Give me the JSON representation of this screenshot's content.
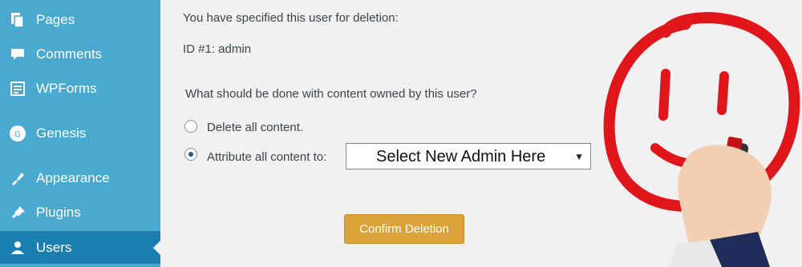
{
  "sidebar": {
    "items": [
      {
        "label": "Pages",
        "icon": "pages-icon"
      },
      {
        "label": "Comments",
        "icon": "comments-icon"
      },
      {
        "label": "WPForms",
        "icon": "wpforms-icon"
      },
      {
        "label": "Genesis",
        "icon": "genesis-icon"
      },
      {
        "label": "Appearance",
        "icon": "appearance-icon"
      },
      {
        "label": "Plugins",
        "icon": "plugins-icon"
      },
      {
        "label": "Users",
        "icon": "users-icon",
        "active": true
      }
    ],
    "bg_color": "#4aa9cf",
    "active_color": "#1a7fb0"
  },
  "main": {
    "specified_text": "You have specified this user for deletion:",
    "user_id_text": "ID #1: admin",
    "question": "What should be done with content owned by this user?",
    "option_delete": "Delete all content.",
    "option_attribute": "Attribute all content to:",
    "select_value": "Select New Admin Here",
    "confirm_button": "Confirm Deletion",
    "selected_option": "attribute",
    "button_color": "#dda33b"
  },
  "overlay": {
    "description_icon": "smiley-face-drawing",
    "stroke_color": "#e0161b"
  }
}
